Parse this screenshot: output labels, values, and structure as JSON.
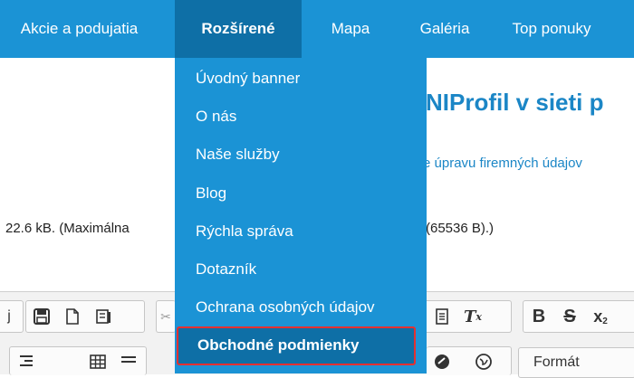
{
  "nav": {
    "items": [
      {
        "label": "Akcie a podujatia"
      },
      {
        "label": "Rozšírené"
      },
      {
        "label": "Mapa"
      },
      {
        "label": "Galéria"
      },
      {
        "label": "Top ponuky"
      }
    ],
    "active_index": 1
  },
  "dropdown": {
    "items": [
      {
        "label": "Úvodný banner"
      },
      {
        "label": "O nás"
      },
      {
        "label": "Naše služby"
      },
      {
        "label": "Blog"
      },
      {
        "label": "Rýchla správa"
      },
      {
        "label": "Dotazník"
      },
      {
        "label": "Ochrana osobných údajov"
      },
      {
        "label": "Obchodné podmienky"
      }
    ],
    "highlighted_index": 7
  },
  "page": {
    "heading_fragment": "NIProfil v sieti p",
    "subtext_fragment": "e úpravu firemných údajov",
    "size_left": "22.6 kB. (Maximálna",
    "size_right": "(65536 B).)"
  },
  "toolbar": {
    "partial_left_glyph": "j",
    "format_label": "Formát"
  },
  "colors": {
    "nav_bg": "#1b93d5",
    "nav_active": "#0e6fa6",
    "highlight_border": "#e53030",
    "link_text": "#1b86c6"
  }
}
